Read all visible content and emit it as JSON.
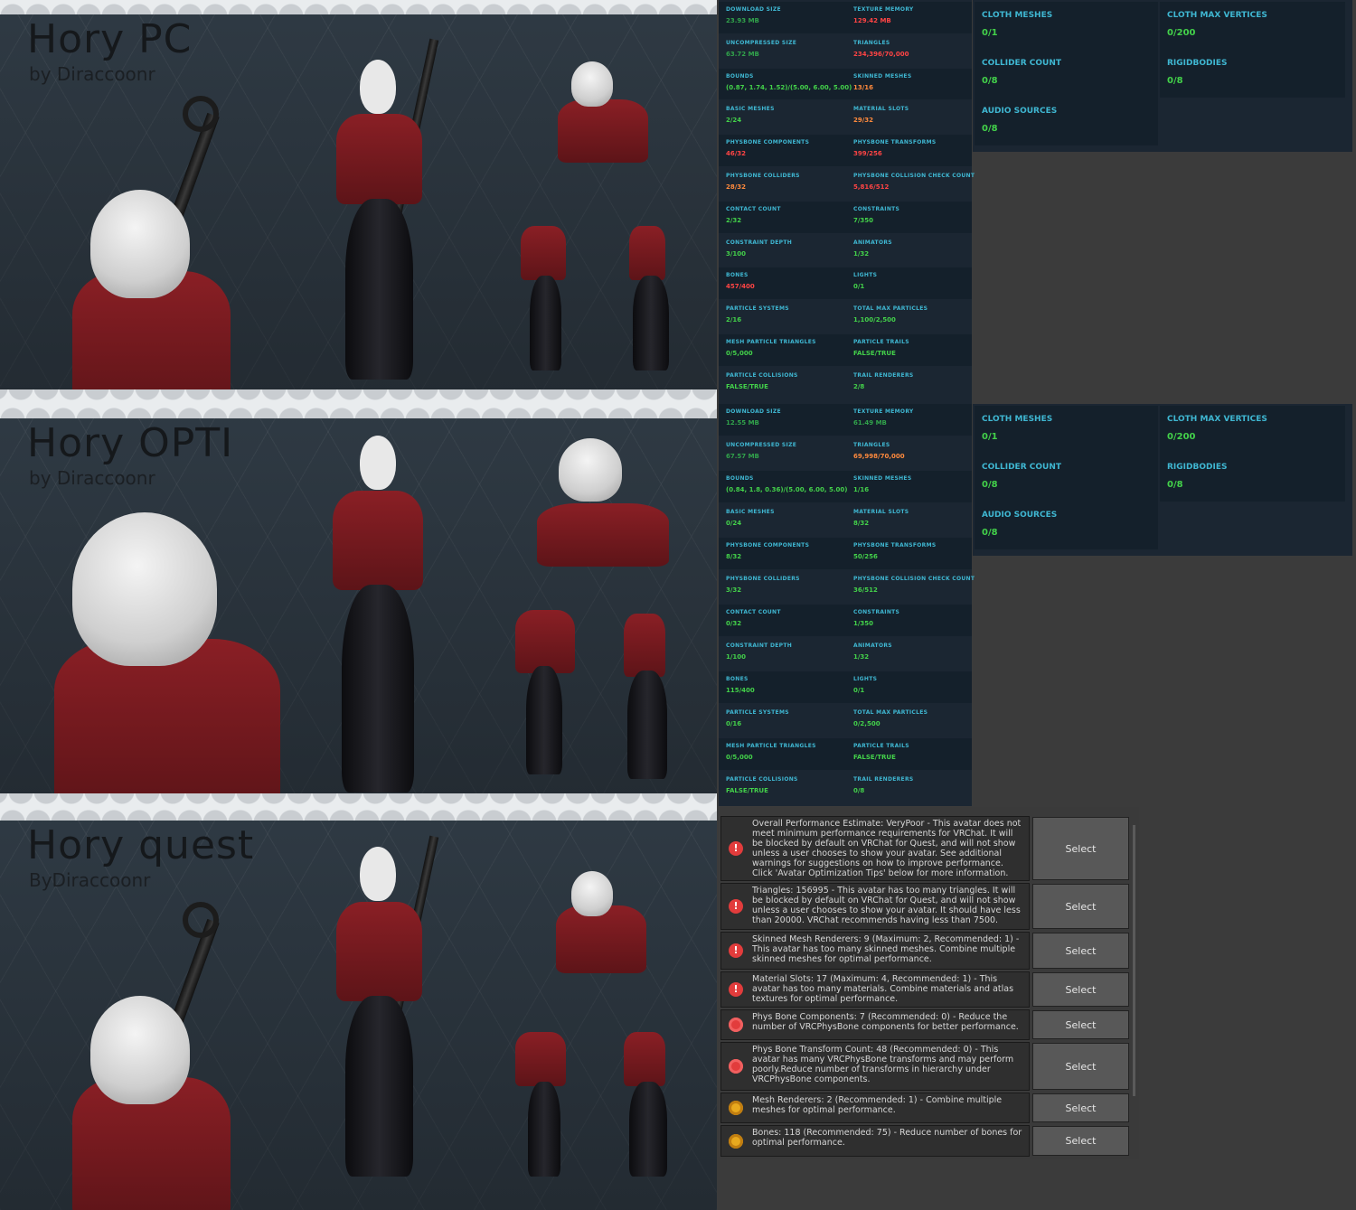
{
  "panels": [
    {
      "title": "Hory PC",
      "subtitle": "by Diraccoonr"
    },
    {
      "title": "Hory OPTI",
      "subtitle": "by Diraccoonr"
    },
    {
      "title": "Hory quest",
      "subtitle": "ByDiraccoonr"
    }
  ],
  "stats_pc": [
    [
      "DOWNLOAD SIZE",
      "23.93 MB",
      "TEXTURE MEMORY",
      "129.42 MB"
    ],
    [
      "UNCOMPRESSED SIZE",
      "63.72 MB",
      "TRIANGLES",
      "234,396/70,000"
    ],
    [
      "BOUNDS",
      "(0.87, 1.74, 1.52)/(5.00, 6.00, 5.00)",
      "SKINNED MESHES",
      "13/16"
    ],
    [
      "BASIC MESHES",
      "2/24",
      "MATERIAL SLOTS",
      "29/32"
    ],
    [
      "PHYSBONE COMPONENTS",
      "46/32",
      "PHYSBONE TRANSFORMS",
      "399/256"
    ],
    [
      "PHYSBONE COLLIDERS",
      "28/32",
      "PHYSBONE COLLISION CHECK COUNT",
      "5,816/512"
    ],
    [
      "CONTACT COUNT",
      "2/32",
      "CONSTRAINTS",
      "7/350"
    ],
    [
      "CONSTRAINT DEPTH",
      "3/100",
      "ANIMATORS",
      "1/32"
    ],
    [
      "BONES",
      "457/400",
      "LIGHTS",
      "0/1"
    ],
    [
      "PARTICLE SYSTEMS",
      "2/16",
      "TOTAL MAX PARTICLES",
      "1,100/2,500"
    ],
    [
      "MESH PARTICLE TRIANGLES",
      "0/5,000",
      "PARTICLE TRAILS",
      "FALSE/TRUE"
    ],
    [
      "PARTICLE COLLISIONS",
      "FALSE/TRUE",
      "TRAIL RENDERERS",
      "2/8"
    ]
  ],
  "stats_opti": [
    [
      "DOWNLOAD SIZE",
      "12.55 MB",
      "TEXTURE MEMORY",
      "61.49 MB"
    ],
    [
      "UNCOMPRESSED SIZE",
      "67.57 MB",
      "TRIANGLES",
      "69,998/70,000"
    ],
    [
      "BOUNDS",
      "(0.84, 1.8, 0.36)/(5.00, 6.00, 5.00)",
      "SKINNED MESHES",
      "1/16"
    ],
    [
      "BASIC MESHES",
      "0/24",
      "MATERIAL SLOTS",
      "8/32"
    ],
    [
      "PHYSBONE COMPONENTS",
      "8/32",
      "PHYSBONE TRANSFORMS",
      "50/256"
    ],
    [
      "PHYSBONE COLLIDERS",
      "3/32",
      "PHYSBONE COLLISION CHECK COUNT",
      "36/512"
    ],
    [
      "CONTACT COUNT",
      "0/32",
      "CONSTRAINTS",
      "1/350"
    ],
    [
      "CONSTRAINT DEPTH",
      "1/100",
      "ANIMATORS",
      "1/32"
    ],
    [
      "BONES",
      "115/400",
      "LIGHTS",
      "0/1"
    ],
    [
      "PARTICLE SYSTEMS",
      "0/16",
      "TOTAL MAX PARTICLES",
      "0/2,500"
    ],
    [
      "MESH PARTICLE TRIANGLES",
      "0/5,000",
      "PARTICLE TRAILS",
      "FALSE/TRUE"
    ],
    [
      "PARTICLE COLLISIONS",
      "FALSE/TRUE",
      "TRAIL RENDERERS",
      "0/8"
    ]
  ],
  "side_pc": [
    [
      "CLOTH MESHES",
      "0/1",
      "CLOTH MAX VERTICES",
      "0/200"
    ],
    [
      "COLLIDER COUNT",
      "0/8",
      "RIGIDBODIES",
      "0/8"
    ],
    [
      "AUDIO SOURCES",
      "0/8",
      "",
      ""
    ]
  ],
  "side_opti": [
    [
      "CLOTH MESHES",
      "0/1",
      "CLOTH MAX VERTICES",
      "0/200"
    ],
    [
      "COLLIDER COUNT",
      "0/8",
      "RIGIDBODIES",
      "0/8"
    ],
    [
      "AUDIO SOURCES",
      "0/8",
      "",
      ""
    ]
  ],
  "warnings": [
    {
      "text": "Overall Performance Estimate: VeryPoor - This avatar does not meet minimum performance requirements for VRChat. It will be blocked by default on VRChat for Quest, and will not show unless a user chooses to show your avatar. See additional warnings for suggestions on how to improve performance. Click 'Avatar Optimization Tips' below for more information.",
      "button": "Select",
      "level": "error"
    },
    {
      "text": "Triangles: 156995 - This avatar has too many triangles. It will be blocked by default on VRChat for Quest, and will not show unless a user chooses to show your avatar. It should have less than 20000. VRChat recommends having less than 7500.",
      "button": "Select",
      "level": "error"
    },
    {
      "text": "Skinned Mesh Renderers: 9 (Maximum: 2, Recommended: 1) - This avatar has too many skinned meshes. Combine multiple skinned meshes for optimal performance.",
      "button": "Select",
      "level": "error"
    },
    {
      "text": "Material Slots: 17 (Maximum: 4, Recommended: 1) - This avatar has too many materials. Combine materials and atlas textures for optimal performance.",
      "button": "Select",
      "level": "error"
    },
    {
      "text": "Phys Bone Components: 7 (Recommended: 0) - Reduce the number of VRCPhysBone components for better performance.",
      "button": "Select",
      "level": "verypoor"
    },
    {
      "text": "Phys Bone Transform Count: 48 (Recommended: 0) - This avatar has many VRCPhysBone transforms and may perform poorly.Reduce number of transforms in hierarchy under VRCPhysBone components.",
      "button": "Select",
      "level": "verypoor"
    },
    {
      "text": "Mesh Renderers: 2 (Recommended: 1) - Combine multiple meshes for optimal performance.",
      "button": "Select",
      "level": "warning"
    },
    {
      "text": "Bones: 118 (Recommended: 75) - Reduce number of bones for optimal performance.",
      "button": "Select",
      "level": "warning"
    }
  ],
  "colors": {
    "ok": "#43d14a",
    "bad": "#ff4444",
    "label": "#3fb7d2",
    "panel_bg": "#1b2632"
  }
}
